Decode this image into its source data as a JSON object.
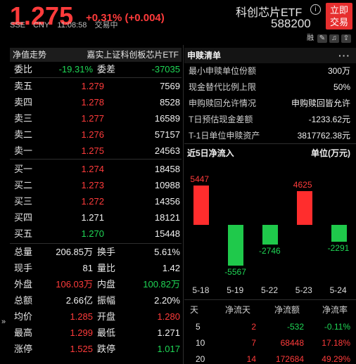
{
  "header": {
    "price": "1.275",
    "change": "+0.31% (+0.004)",
    "market": "SSE",
    "currency": "CNY",
    "time": "11:08:58",
    "status": "交易中",
    "fund_name": "科创芯片ETF",
    "info_icon": "i",
    "trade_button": [
      "立即",
      "交易"
    ],
    "code": "588200",
    "tool_icons": [
      "融",
      "edit-icon",
      "bell-icon",
      "share-icon"
    ]
  },
  "left": {
    "head_left": "净值走势",
    "head_right": "嘉实上证科创板芯片ETF",
    "weibi": {
      "label": "委比",
      "value": "-19.31%",
      "label2": "委差",
      "value2": "-37035"
    },
    "asks": [
      {
        "label": "卖五",
        "price": "1.279",
        "vol": "7569"
      },
      {
        "label": "卖四",
        "price": "1.278",
        "vol": "8528"
      },
      {
        "label": "卖三",
        "price": "1.277",
        "vol": "16589"
      },
      {
        "label": "卖二",
        "price": "1.276",
        "vol": "57157"
      },
      {
        "label": "卖一",
        "price": "1.275",
        "vol": "24563"
      }
    ],
    "bids": [
      {
        "label": "买一",
        "price": "1.274",
        "vol": "18458"
      },
      {
        "label": "买二",
        "price": "1.273",
        "vol": "10988"
      },
      {
        "label": "买三",
        "price": "1.272",
        "vol": "14356"
      },
      {
        "label": "买四",
        "price": "1.271",
        "vol": "18121"
      },
      {
        "label": "买五",
        "price": "1.270",
        "vol": "15448"
      }
    ],
    "stats": [
      {
        "k1": "总量",
        "v1": "206.85万",
        "k2": "换手",
        "v2": "5.61%"
      },
      {
        "k1": "现手",
        "v1": "81",
        "k2": "量比",
        "v2": "1.42"
      },
      {
        "k1": "外盘",
        "v1": "106.03万",
        "k2": "内盘",
        "v2": "100.82万"
      },
      {
        "k1": "总额",
        "v1": "2.66亿",
        "k2": "振幅",
        "v2": "2.20%"
      },
      {
        "k1": "均价",
        "v1": "1.285",
        "k2": "开盘",
        "v2": "1.280"
      },
      {
        "k1": "最高",
        "v1": "1.299",
        "k2": "最低",
        "v2": "1.271"
      },
      {
        "k1": "涨停",
        "v1": "1.525",
        "k2": "跌停",
        "v2": "1.017"
      }
    ],
    "side_arrow": "»"
  },
  "right": {
    "title": "申赎清单",
    "more": "···",
    "rows": [
      {
        "k": "最小申赎单位份额",
        "v": "300万"
      },
      {
        "k": "现金替代比例上限",
        "v": "50%"
      },
      {
        "k": "申购赎回允许情况",
        "v": "申购赎回皆允许"
      },
      {
        "k": "T日预估现金差额",
        "v": "-1233.62元"
      },
      {
        "k": "T-1日单位申赎资产",
        "v": "3817762.38元"
      }
    ],
    "flow_title": "近5日净流入",
    "flow_unit": "单位(万元)",
    "flow_table_head": [
      "天",
      "净流天",
      "净流额",
      "净流率"
    ],
    "flow_table": [
      {
        "d": "5",
        "n": "2",
        "amt": "-532",
        "rate": "-0.11%"
      },
      {
        "d": "10",
        "n": "7",
        "amt": "68448",
        "rate": "17.18%"
      },
      {
        "d": "20",
        "n": "14",
        "amt": "172684",
        "rate": "49.29%"
      }
    ]
  },
  "chart_data": {
    "type": "bar",
    "title": "近5日净流入",
    "ylabel": "单位(万元)",
    "categories": [
      "5-18",
      "5-19",
      "5-22",
      "5-23",
      "5-24"
    ],
    "values": [
      5447,
      -5567,
      -2746,
      4625,
      -2291
    ],
    "colors": {
      "positive": "#ff2d2d",
      "negative": "#1fc94b"
    }
  }
}
